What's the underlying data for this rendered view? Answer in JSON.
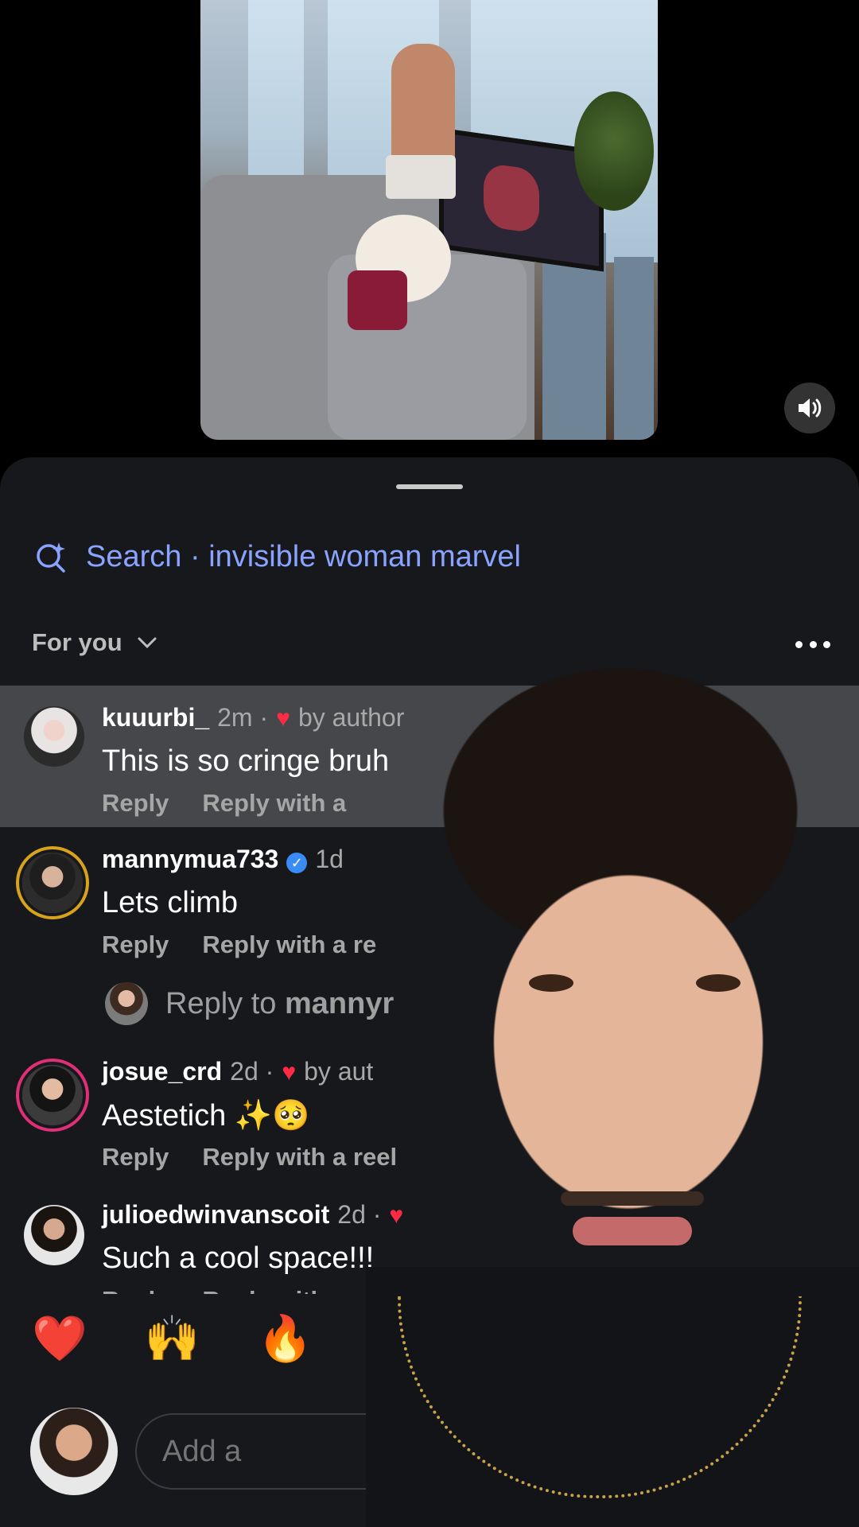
{
  "video": {
    "mute_icon": "speaker-icon"
  },
  "sheet": {
    "search_prefix": "Search",
    "search_separator": "·",
    "search_query": "invisible woman marvel",
    "sort_label": "For you"
  },
  "comments": [
    {
      "username": "kuuurbi_",
      "time": "2m ·",
      "liked_by": "by author",
      "text": "This is so cringe bruh",
      "reply": "Reply",
      "reply_reel": "Reply with a"
    },
    {
      "username": "mannymua733",
      "time": "1d",
      "text": "Lets climb",
      "reply": "Reply",
      "reply_reel": "Reply with a re"
    },
    {
      "username": "josue_crd",
      "time": "2d ·",
      "liked_by": "by aut",
      "text": "Aestetich ✨🥺",
      "reply": "Reply",
      "reply_reel": "Reply with a reel"
    },
    {
      "username": "julioedwinvanscoit",
      "time": "2d ·",
      "text": "Such a cool space!!!",
      "reply": "Reply",
      "reply_reel": "Reply with a r"
    }
  ],
  "reply_to": {
    "label": "Reply to",
    "user": "mannyr"
  },
  "emoji_bar": [
    "❤️",
    "🙌",
    "🔥"
  ],
  "composer": {
    "placeholder": "Add a"
  },
  "colors": {
    "accent": "#8aa3ff",
    "sheet_bg": "#16181c",
    "like": "#ff2b45"
  }
}
